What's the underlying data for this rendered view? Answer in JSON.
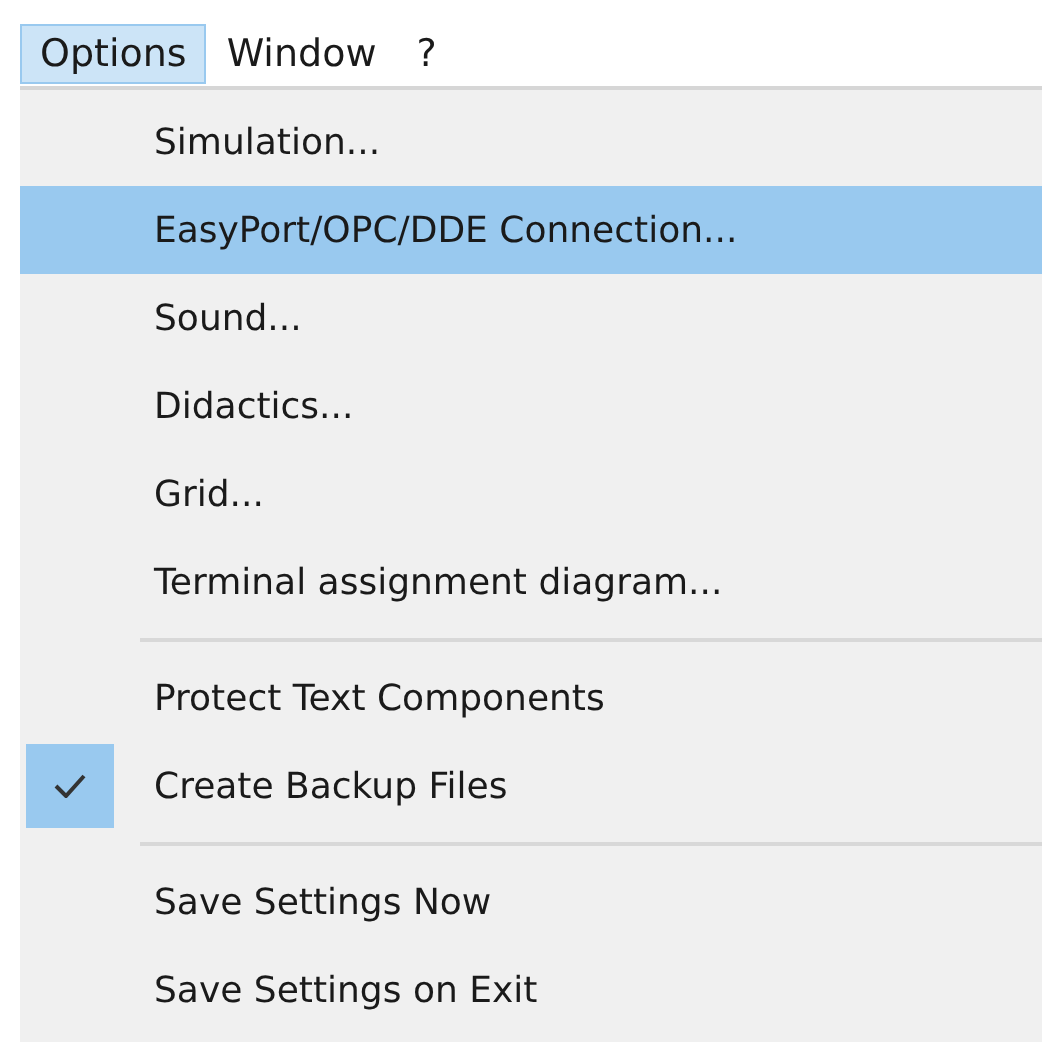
{
  "menu_bar": [
    {
      "label": "Options",
      "selected": true
    },
    {
      "label": "Window",
      "selected": false
    },
    {
      "label": "?",
      "selected": false
    }
  ],
  "menu": {
    "items": [
      {
        "kind": "item",
        "label": "Simulation...",
        "selected": false,
        "checked": false
      },
      {
        "kind": "item",
        "label": "EasyPort/OPC/DDE Connection...",
        "selected": true,
        "checked": false
      },
      {
        "kind": "item",
        "label": "Sound...",
        "selected": false,
        "checked": false
      },
      {
        "kind": "item",
        "label": "Didactics...",
        "selected": false,
        "checked": false
      },
      {
        "kind": "item",
        "label": "Grid...",
        "selected": false,
        "checked": false
      },
      {
        "kind": "item",
        "label": "Terminal assignment diagram...",
        "selected": false,
        "checked": false
      },
      {
        "kind": "separator"
      },
      {
        "kind": "item",
        "label": "Protect Text Components",
        "selected": false,
        "checked": false
      },
      {
        "kind": "item",
        "label": "Create Backup Files",
        "selected": false,
        "checked": true
      },
      {
        "kind": "separator"
      },
      {
        "kind": "item",
        "label": "Save Settings Now",
        "selected": false,
        "checked": false
      },
      {
        "kind": "item",
        "label": "Save Settings on Exit",
        "selected": false,
        "checked": false
      }
    ]
  }
}
